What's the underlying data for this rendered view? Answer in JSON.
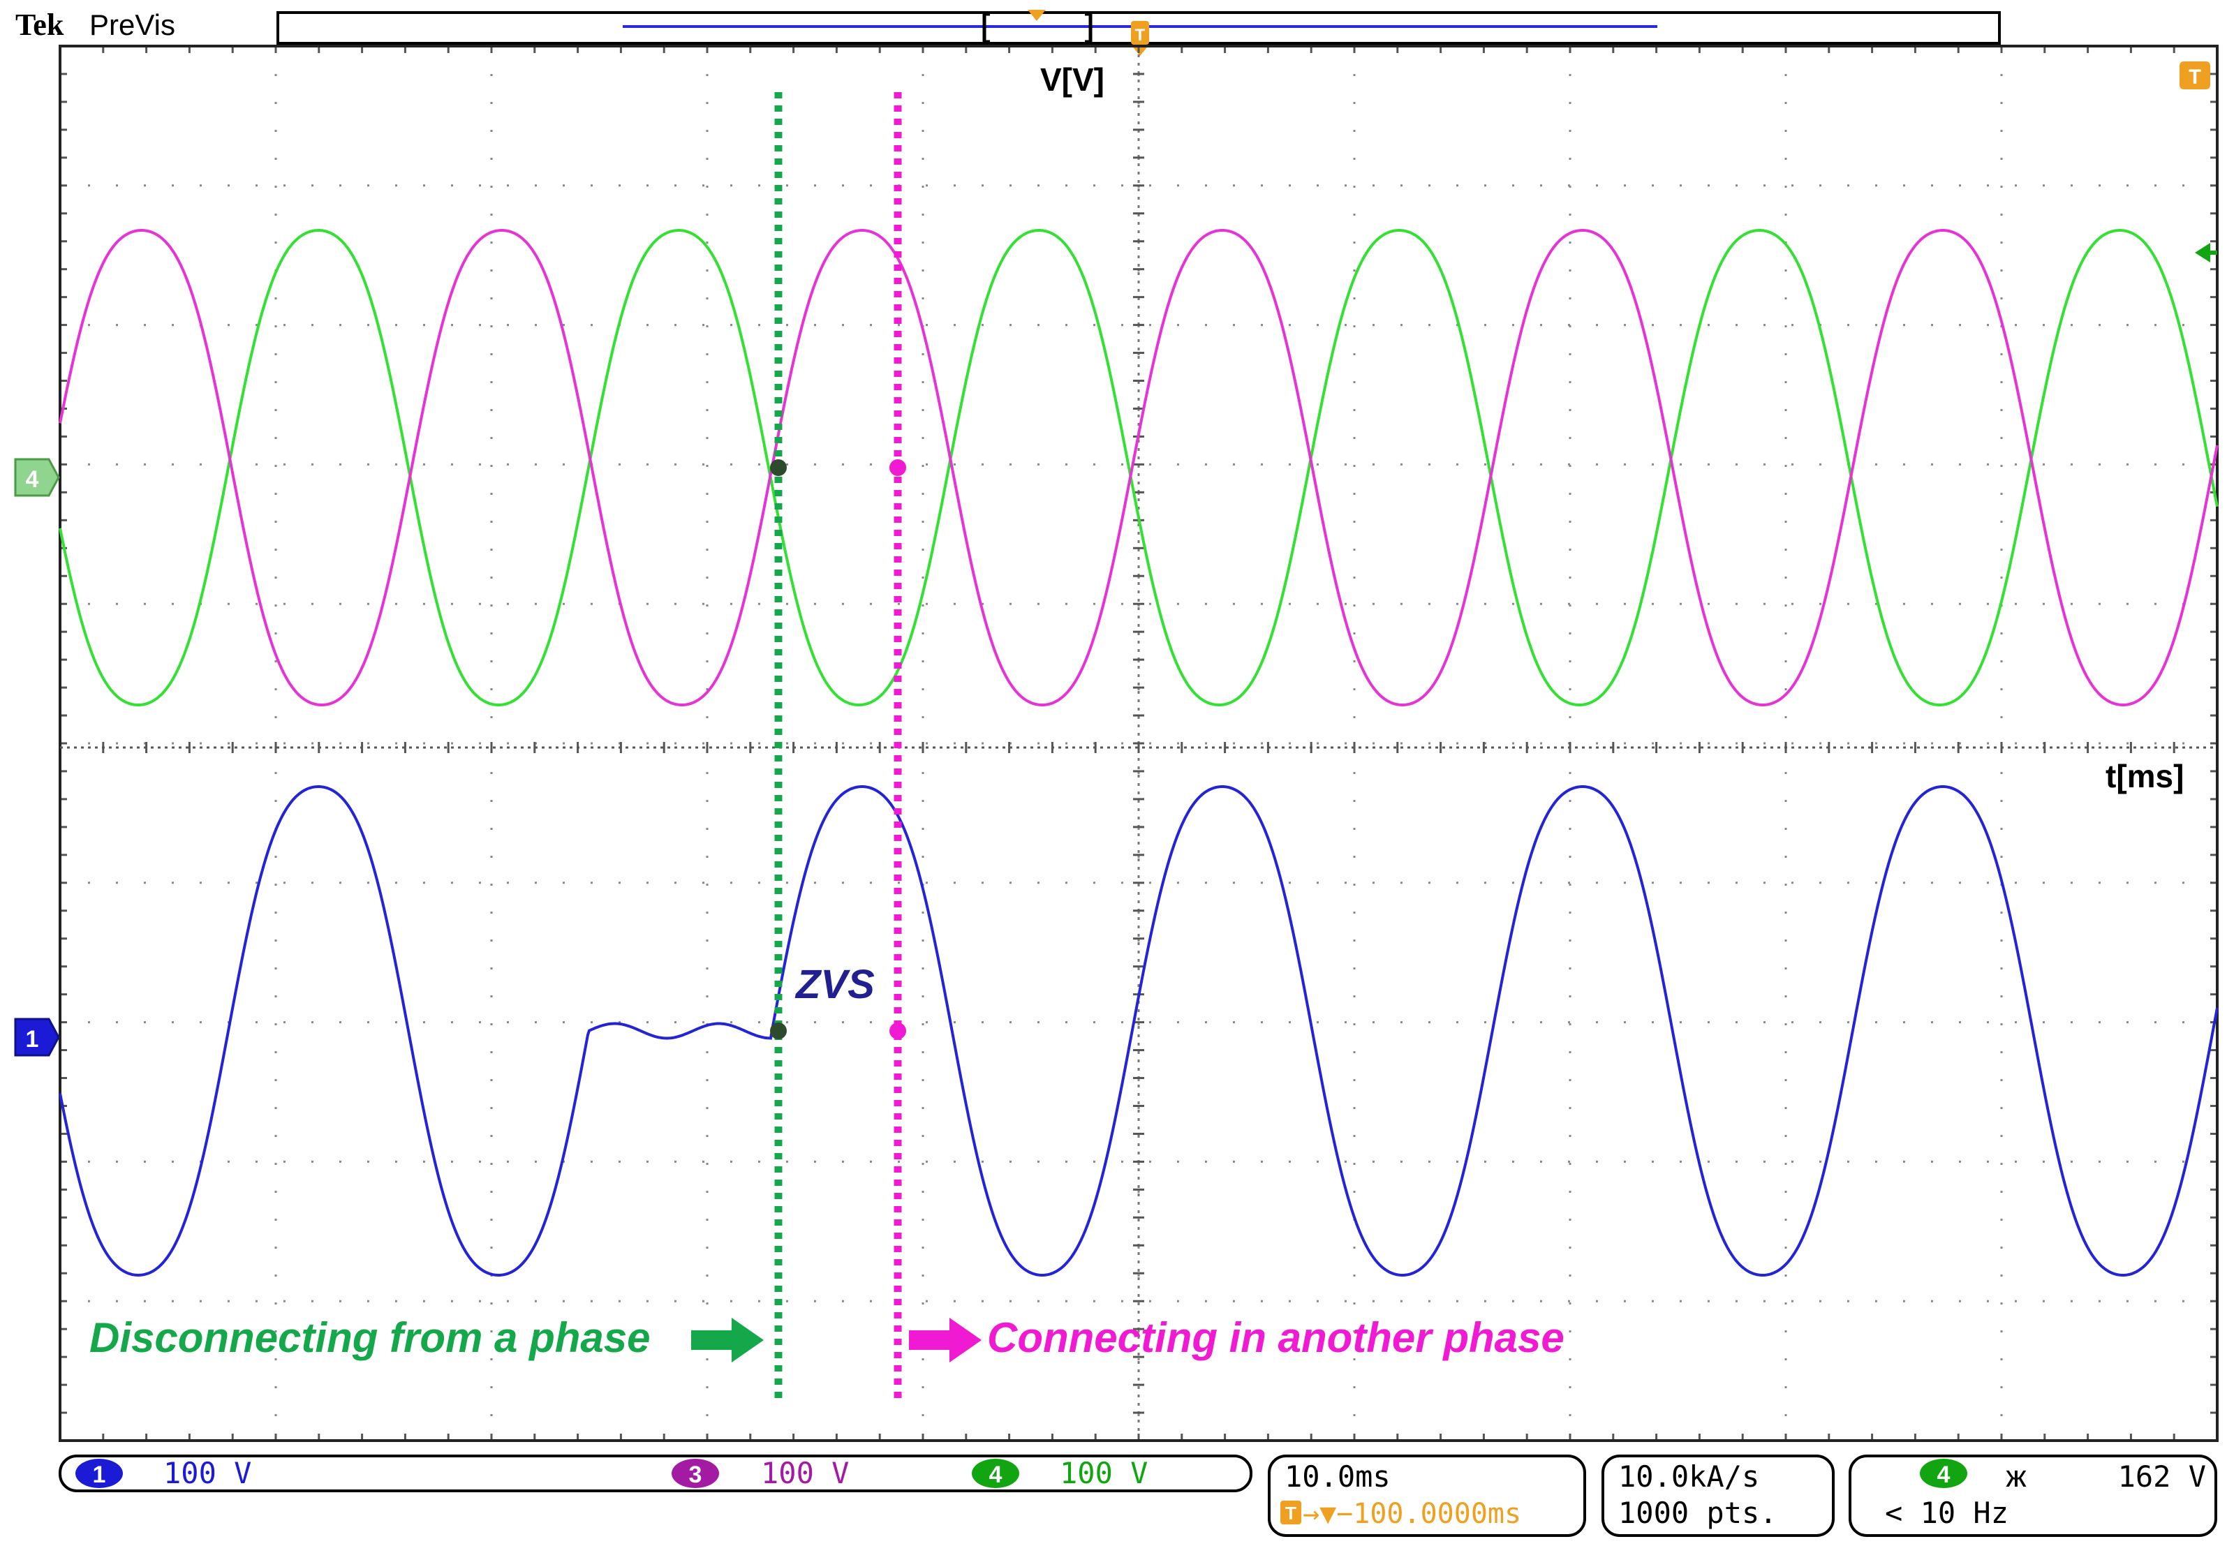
{
  "header": {
    "brand": "Tek",
    "mode": "PreVis"
  },
  "channels": {
    "ch1": {
      "number": "1",
      "scale": "100 V",
      "color": "#1b1bd6",
      "marker": "1"
    },
    "ch3": {
      "number": "3",
      "scale": "100 V",
      "color": "#a31aa3"
    },
    "ch4": {
      "number": "4",
      "scale": "100 V",
      "color": "#11a611",
      "marker": "4"
    }
  },
  "trace_colors": {
    "green": "#33e033",
    "magenta": "#e633d6",
    "blue": "#2323d8"
  },
  "timebase": {
    "scale": "10.0ms",
    "trigger_position": "→▼−100.0000ms",
    "trigger_glyph": "T"
  },
  "acquisition": {
    "rate": "10.0kA/s",
    "points": "1000 pts."
  },
  "trigger_readout": {
    "channel": "4",
    "coupling_icon": "ж",
    "level": "162 V",
    "frequency": "< 10 Hz"
  },
  "annotations": {
    "y_axis": "V[V]",
    "x_axis": "t[ms]",
    "zvs": "ZVS",
    "disconnect": "Disconnecting from a phase",
    "connect": "Connecting in another phase",
    "disconnect_color": "#14a84a",
    "connect_color": "#f01ad2",
    "zvs_color": "#202090"
  },
  "waveforms": {
    "period_ms": 16.7,
    "upper_amplitude_divs": 1.7,
    "lower_amplitude_divs": 1.75,
    "switch_off_ms": -25.5,
    "switch_on_ms": -17.0
  }
}
